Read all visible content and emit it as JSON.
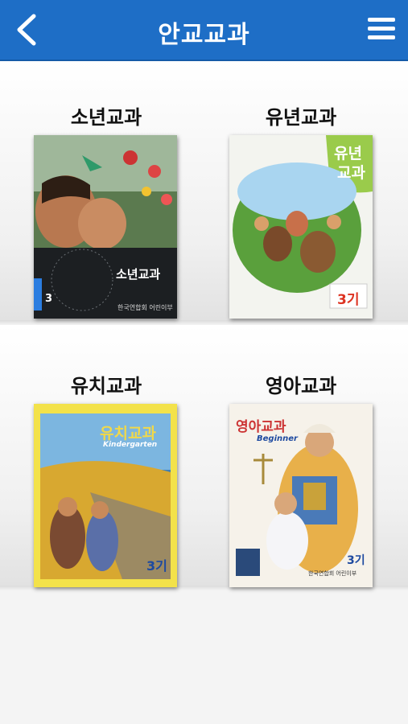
{
  "header": {
    "title": "안교교과"
  },
  "books": [
    {
      "label": "소년교과",
      "cover_title": "소년교과",
      "cover_number": "3",
      "publisher": "한국연합회 어린이부"
    },
    {
      "label": "유년교과",
      "cover_title_line1": "유년",
      "cover_title_line2": "교과",
      "cover_number": "3기"
    },
    {
      "label": "유치교과",
      "cover_title": "유치교과",
      "cover_subtitle": "Kindergarten",
      "cover_number": "3기"
    },
    {
      "label": "영아교과",
      "cover_title": "영아교과",
      "cover_subtitle": "Beginner",
      "cover_number": "3기",
      "publisher": "한국연합회 어린이부"
    }
  ],
  "colors": {
    "header": "#1e6ec6",
    "background": "#f4f4f4"
  },
  "icons": {
    "back": "chevron-left-icon",
    "menu": "hamburger-menu-icon"
  }
}
